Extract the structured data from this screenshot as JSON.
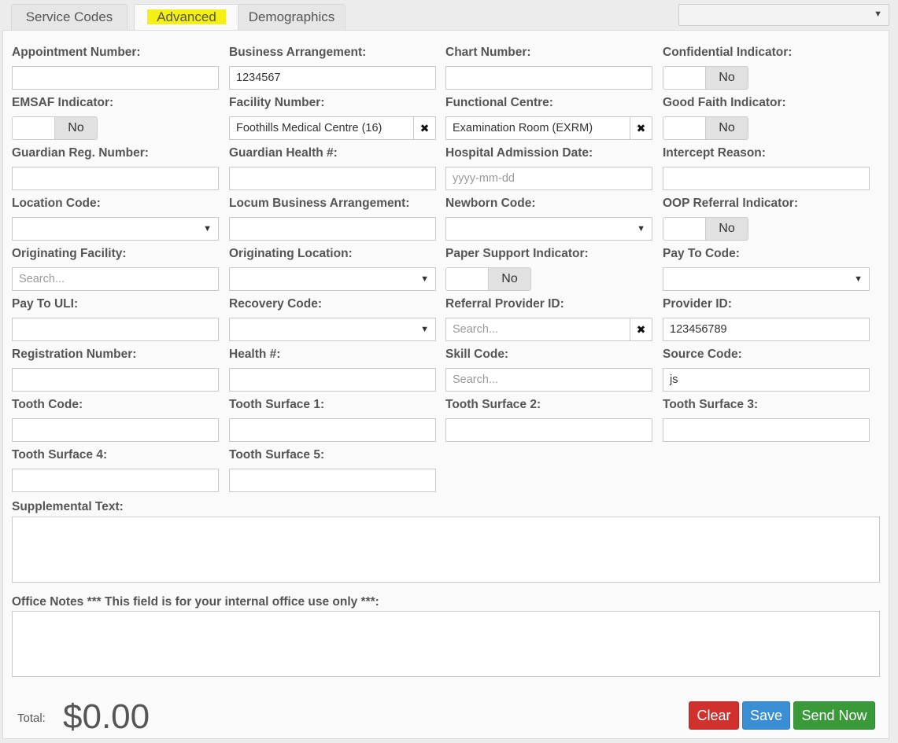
{
  "tabs": [
    {
      "label": "Service Codes"
    },
    {
      "label": "Advanced"
    },
    {
      "label": "Demographics"
    }
  ],
  "tab_select": {
    "value": ""
  },
  "fields": {
    "appointment_number": {
      "label": "Appointment Number:",
      "value": ""
    },
    "business_arrangement": {
      "label": "Business Arrangement:",
      "value": "1234567"
    },
    "chart_number": {
      "label": "Chart Number:",
      "value": ""
    },
    "confidential_indicator": {
      "label": "Confidential Indicator:",
      "value": "No"
    },
    "emsaf_indicator": {
      "label": "EMSAF Indicator:",
      "value": "No"
    },
    "facility_number": {
      "label": "Facility Number:",
      "value": "Foothills Medical Centre (16)"
    },
    "functional_centre": {
      "label": "Functional Centre:",
      "value": "Examination Room (EXRM)"
    },
    "good_faith_indicator": {
      "label": "Good Faith Indicator:",
      "value": "No"
    },
    "guardian_reg_number": {
      "label": "Guardian Reg. Number:",
      "value": ""
    },
    "guardian_health": {
      "label": "Guardian Health #:",
      "value": ""
    },
    "hospital_admission_date": {
      "label": "Hospital Admission Date:",
      "placeholder": "yyyy-mm-dd"
    },
    "intercept_reason": {
      "label": "Intercept Reason:",
      "value": ""
    },
    "location_code": {
      "label": "Location Code:",
      "value": ""
    },
    "locum_business_arrangement": {
      "label": "Locum Business Arrangement:",
      "value": ""
    },
    "newborn_code": {
      "label": "Newborn Code:",
      "value": ""
    },
    "oop_referral_indicator": {
      "label": "OOP Referral Indicator:",
      "value": "No"
    },
    "originating_facility": {
      "label": "Originating Facility:",
      "placeholder": "Search..."
    },
    "originating_location": {
      "label": "Originating Location:",
      "value": ""
    },
    "paper_support_indicator": {
      "label": "Paper Support Indicator:",
      "value": "No"
    },
    "pay_to_code": {
      "label": "Pay To Code:",
      "value": ""
    },
    "pay_to_uli": {
      "label": "Pay To ULI:",
      "value": ""
    },
    "recovery_code": {
      "label": "Recovery Code:",
      "value": ""
    },
    "referral_provider_id": {
      "label": "Referral Provider ID:",
      "placeholder": "Search..."
    },
    "provider_id": {
      "label": "Provider ID:",
      "value": "123456789"
    },
    "registration_number": {
      "label": "Registration Number:",
      "value": ""
    },
    "health_number": {
      "label": "Health #:",
      "value": ""
    },
    "skill_code": {
      "label": "Skill Code:",
      "placeholder": "Search..."
    },
    "source_code": {
      "label": "Source Code:",
      "value": "js"
    },
    "tooth_code": {
      "label": "Tooth Code:",
      "value": ""
    },
    "tooth_surface_1": {
      "label": "Tooth Surface 1:",
      "value": ""
    },
    "tooth_surface_2": {
      "label": "Tooth Surface 2:",
      "value": ""
    },
    "tooth_surface_3": {
      "label": "Tooth Surface 3:",
      "value": ""
    },
    "tooth_surface_4": {
      "label": "Tooth Surface 4:",
      "value": ""
    },
    "tooth_surface_5": {
      "label": "Tooth Surface 5:",
      "value": ""
    }
  },
  "supplemental_text": {
    "label": "Supplemental Text:",
    "value": ""
  },
  "office_notes": {
    "label": "Office Notes *** This field is for your internal office use only ***:",
    "value": ""
  },
  "footer": {
    "total_label": "Total:",
    "total_value": "$0.00",
    "clear_label": "Clear",
    "save_label": "Save",
    "send_label": "Send Now"
  },
  "icons": {
    "clear": "✖",
    "caret": "▼"
  },
  "colors": {
    "tab_highlight": "#f4f015",
    "clear": "#d0312d",
    "save": "#3a8fd4",
    "send": "#3a9a3a"
  }
}
